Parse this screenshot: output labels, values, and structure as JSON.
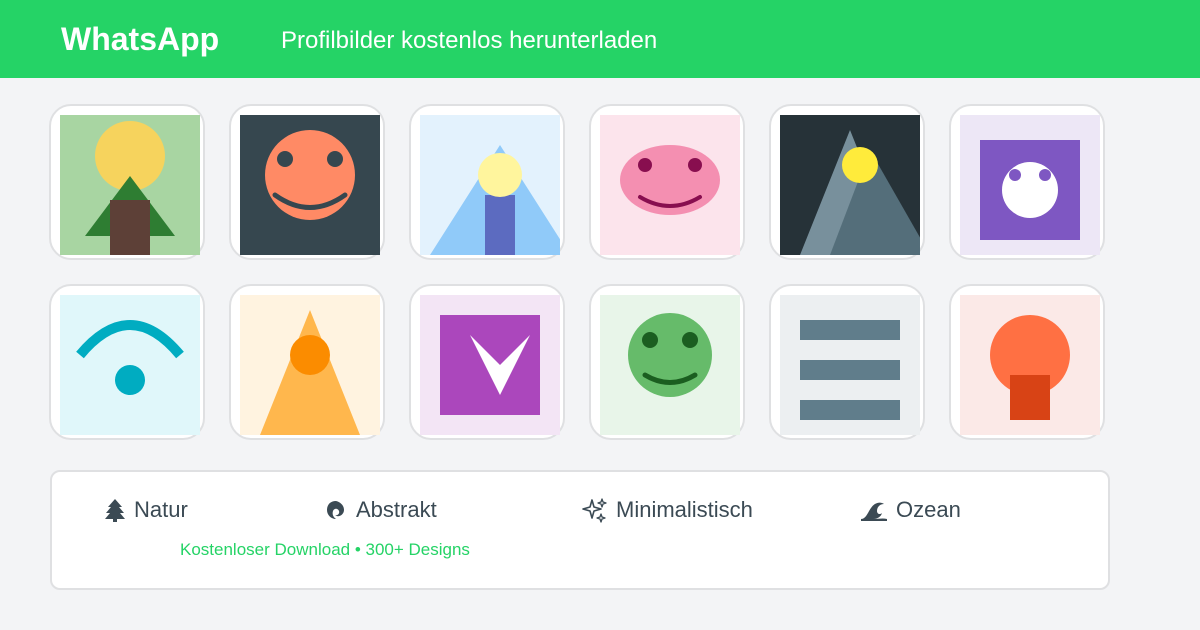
{
  "header": {
    "brand": "WhatsApp",
    "tagline": "Profilbilder kostenlos herunterladen"
  },
  "colors": {
    "brand": "#25d366",
    "text": "#3b4a54"
  },
  "gallery": [
    {
      "name": "tree-sun-avatar"
    },
    {
      "name": "orange-smiley-avatar"
    },
    {
      "name": "lighthouse-avatar"
    },
    {
      "name": "pink-blob-avatar"
    },
    {
      "name": "night-mountain-avatar"
    },
    {
      "name": "purple-ghost-avatar"
    },
    {
      "name": "wifi-signal-avatar"
    },
    {
      "name": "orange-triangle-avatar"
    },
    {
      "name": "purple-chevron-avatar"
    },
    {
      "name": "green-smiley-avatar"
    },
    {
      "name": "menu-lines-avatar"
    },
    {
      "name": "orange-mushroom-avatar"
    }
  ],
  "categories": [
    {
      "label": "Natur",
      "icon": "tree-icon"
    },
    {
      "label": "Abstrakt",
      "icon": "swirl-icon"
    },
    {
      "label": "Minimalistisch",
      "icon": "sparkle-icon"
    },
    {
      "label": "Ozean",
      "icon": "wave-icon"
    }
  ],
  "footnote": "Kostenloser Download • 300+ Designs"
}
